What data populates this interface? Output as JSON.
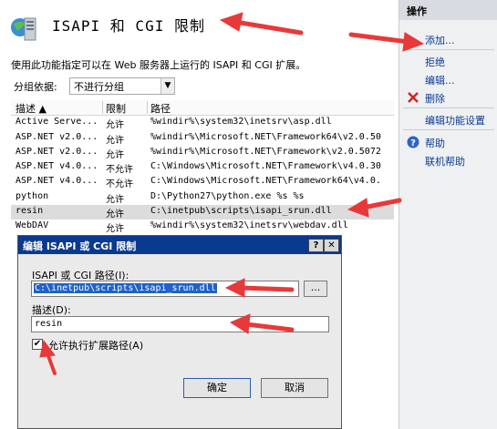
{
  "header": {
    "title": "ISAPI 和 CGI 限制",
    "description": "使用此功能指定可以在 Web 服务器上运行的 ISAPI 和 CGI 扩展。",
    "icon": "server-icon"
  },
  "groupby": {
    "label": "分组依据:",
    "value": "不进行分组"
  },
  "table": {
    "columns": [
      "描述",
      "限制",
      "路径"
    ],
    "rows": [
      {
        "desc": "Active Serve...",
        "restriction": "允许",
        "path": "%windir%\\system32\\inetsrv\\asp.dll"
      },
      {
        "desc": "ASP.NET v2.0...",
        "restriction": "允许",
        "path": "%windir%\\Microsoft.NET\\Framework64\\v2.0.50"
      },
      {
        "desc": "ASP.NET v2.0...",
        "restriction": "允许",
        "path": "%windir%\\Microsoft.NET\\Framework\\v2.0.5072"
      },
      {
        "desc": "ASP.NET v4.0...",
        "restriction": "不允许",
        "path": "C:\\Windows\\Microsoft.NET\\Framework\\v4.0.30"
      },
      {
        "desc": "ASP.NET v4.0...",
        "restriction": "不允许",
        "path": "C:\\Windows\\Microsoft.NET\\Framework64\\v4.0."
      },
      {
        "desc": "python",
        "restriction": "允许",
        "path": "D:\\Python27\\python.exe %s %s"
      },
      {
        "desc": "resin",
        "restriction": "允许",
        "path": "C:\\inetpub\\scripts\\isapi_srun.dll"
      },
      {
        "desc": "WebDAV",
        "restriction": "允许",
        "path": "%windir%\\system32\\inetsrv\\webdav.dll"
      }
    ]
  },
  "actions": {
    "title": "操作",
    "items": {
      "add": "添加...",
      "deny": "拒绝",
      "edit": "编辑...",
      "delete": "删除",
      "edit_settings": "编辑功能设置",
      "help": "帮助",
      "online_help": "联机帮助"
    }
  },
  "dialog": {
    "title": "编辑 ISAPI 或 CGI 限制",
    "help_btn": "?",
    "close_btn": "✕",
    "path_label": "ISAPI 或 CGI 路径(I):",
    "path_value": "C:\\inetpub\\scripts\\isapi_srun.dll",
    "browse_btn": "...",
    "desc_label": "描述(D):",
    "desc_value": "resin",
    "allow_label": "允许执行扩展路径(A)",
    "allow_checked": "✔",
    "ok_btn": "确定",
    "cancel_btn": "取消"
  },
  "colors": {
    "dialog_titlebar": "#0a3a8d",
    "selection": "#1f62c9",
    "arrow": "#e8393a"
  }
}
